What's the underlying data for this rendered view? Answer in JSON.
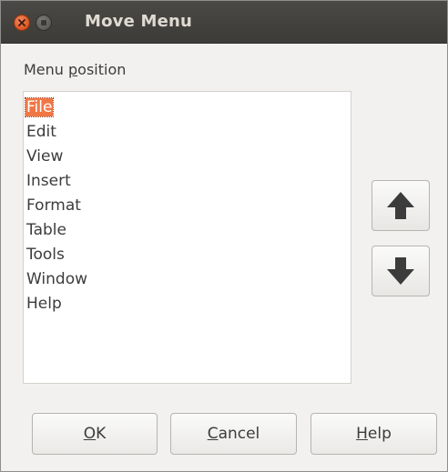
{
  "window": {
    "title": "Move Menu"
  },
  "section": {
    "label_prefix": "Menu ",
    "label_mnemonic": "p",
    "label_suffix": "osition"
  },
  "menu_list": {
    "selected_index": 0,
    "items": [
      {
        "label": "File"
      },
      {
        "label": "Edit"
      },
      {
        "label": "View"
      },
      {
        "label": "Insert"
      },
      {
        "label": "Format"
      },
      {
        "label": "Table"
      },
      {
        "label": "Tools"
      },
      {
        "label": "Window"
      },
      {
        "label": "Help"
      }
    ]
  },
  "buttons": {
    "move_up_icon": "arrow-up-icon",
    "move_down_icon": "arrow-down-icon",
    "ok_mnemonic": "O",
    "ok_rest": "K",
    "cancel_mnemonic": "C",
    "cancel_rest": "ancel",
    "help_mnemonic": "H",
    "help_rest": "elp"
  },
  "colors": {
    "titlebar": "#3c3b37",
    "selection": "#f07746",
    "close_button": "#e05b2a"
  }
}
